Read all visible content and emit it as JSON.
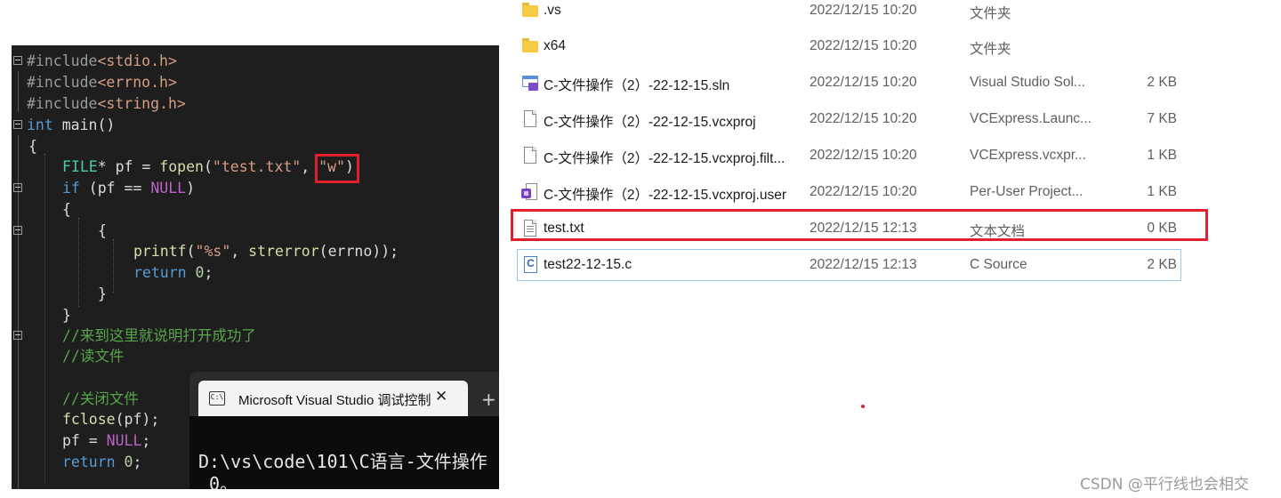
{
  "editor": {
    "lines": [
      {
        "parts": [
          {
            "t": "#include",
            "c": "pp"
          },
          {
            "t": "<stdio.h>",
            "c": "str"
          }
        ]
      },
      {
        "parts": [
          {
            "t": "#include",
            "c": "pp"
          },
          {
            "t": "<errno.h>",
            "c": "str"
          }
        ]
      },
      {
        "parts": [
          {
            "t": "#include",
            "c": "pp"
          },
          {
            "t": "<string.h>",
            "c": "str"
          }
        ]
      },
      {
        "parts": [
          {
            "t": "int",
            "c": "kw"
          },
          {
            "t": " main()",
            "c": ""
          }
        ]
      },
      {
        "parts": [
          {
            "t": "{",
            "c": ""
          }
        ]
      },
      {
        "parts": [
          {
            "t": "FILE",
            "c": "ty"
          },
          {
            "t": "* pf = ",
            "c": ""
          },
          {
            "t": "fopen",
            "c": "fn"
          },
          {
            "t": "(",
            "c": ""
          },
          {
            "t": "\"test.txt\"",
            "c": "str"
          },
          {
            "t": ", ",
            "c": ""
          },
          {
            "t": "\"w\"",
            "c": "str"
          },
          {
            "t": ")",
            "c": ""
          }
        ]
      },
      {
        "parts": [
          {
            "t": "if",
            "c": "kw"
          },
          {
            "t": " (pf == ",
            "c": ""
          },
          {
            "t": "NULL",
            "c": "mac"
          },
          {
            "t": ")",
            "c": ""
          }
        ]
      },
      {
        "parts": [
          {
            "t": "{",
            "c": ""
          }
        ]
      },
      {
        "parts": [
          {
            "t": "{",
            "c": ""
          }
        ]
      },
      {
        "parts": [
          {
            "t": "printf",
            "c": "fn"
          },
          {
            "t": "(",
            "c": ""
          },
          {
            "t": "\"%s\"",
            "c": "str"
          },
          {
            "t": ", ",
            "c": ""
          },
          {
            "t": "strerror",
            "c": "fn"
          },
          {
            "t": "(errno));",
            "c": ""
          }
        ]
      },
      {
        "parts": [
          {
            "t": "return",
            "c": "kw"
          },
          {
            "t": " ",
            "c": ""
          },
          {
            "t": "0",
            "c": "num"
          },
          {
            "t": ";",
            "c": ""
          }
        ]
      },
      {
        "parts": [
          {
            "t": "}",
            "c": ""
          }
        ]
      },
      {
        "parts": [
          {
            "t": "}",
            "c": ""
          }
        ]
      },
      {
        "parts": [
          {
            "t": "//来到这里就说明打开成功了",
            "c": "cm"
          }
        ]
      },
      {
        "parts": [
          {
            "t": "//读文件",
            "c": "cm"
          }
        ]
      },
      {
        "parts": [
          {
            "t": "",
            "c": ""
          }
        ]
      },
      {
        "parts": [
          {
            "t": "//关闭文件",
            "c": "cm"
          }
        ]
      },
      {
        "parts": [
          {
            "t": "fclose",
            "c": "fn"
          },
          {
            "t": "(pf);",
            "c": ""
          }
        ]
      },
      {
        "parts": [
          {
            "t": "pf = ",
            "c": ""
          },
          {
            "t": "NULL",
            "c": "mac"
          },
          {
            "t": ";",
            "c": ""
          }
        ]
      },
      {
        "parts": [
          {
            "t": "return",
            "c": "kw"
          },
          {
            "t": " ",
            "c": ""
          },
          {
            "t": "0",
            "c": "num"
          },
          {
            "t": ";",
            "c": ""
          }
        ]
      }
    ]
  },
  "console": {
    "tab_title": "Microsoft Visual Studio 调试控制台",
    "close_glyph": "✕",
    "new_tab_glyph": "+",
    "icon_text": "C:\\",
    "output_line1": "D:\\vs\\code\\101\\C语言-文件操作",
    "output_line2": " 0。"
  },
  "files": [
    {
      "icon": "folder-icon",
      "name": ".vs",
      "date": "2022/12/15 10:20",
      "type": "文件夹",
      "size": ""
    },
    {
      "icon": "folder-icon",
      "name": "x64",
      "date": "2022/12/15 10:20",
      "type": "文件夹",
      "size": ""
    },
    {
      "icon": "solution-icon",
      "name": "C-文件操作（2）-22-12-15.sln",
      "date": "2022/12/15 10:20",
      "type": "Visual Studio Sol...",
      "size": "2 KB"
    },
    {
      "icon": "document-icon",
      "name": "C-文件操作（2）-22-12-15.vcxproj",
      "date": "2022/12/15 10:20",
      "type": "VCExpress.Launc...",
      "size": "7 KB"
    },
    {
      "icon": "document-icon",
      "name": "C-文件操作（2）-22-12-15.vcxproj.filt...",
      "date": "2022/12/15 10:20",
      "type": "VCExpress.vcxpr...",
      "size": "1 KB"
    },
    {
      "icon": "user-file-icon",
      "name": "C-文件操作（2）-22-12-15.vcxproj.user",
      "date": "2022/12/15 10:20",
      "type": "Per-User Project...",
      "size": "1 KB"
    },
    {
      "icon": "text-file-icon",
      "name": "test.txt",
      "date": "2022/12/15 12:13",
      "type": "文本文档",
      "size": "0 KB"
    },
    {
      "icon": "c-source-icon",
      "name": "test22-12-15.c",
      "date": "2022/12/15 12:13",
      "type": "C Source",
      "size": "2 KB"
    }
  ],
  "watermark": "CSDN @平行线也会相交",
  "colors": {
    "highlight_red": "#e0202c",
    "selection_border": "#99c9ef",
    "editor_bg": "#1e1e1e"
  }
}
